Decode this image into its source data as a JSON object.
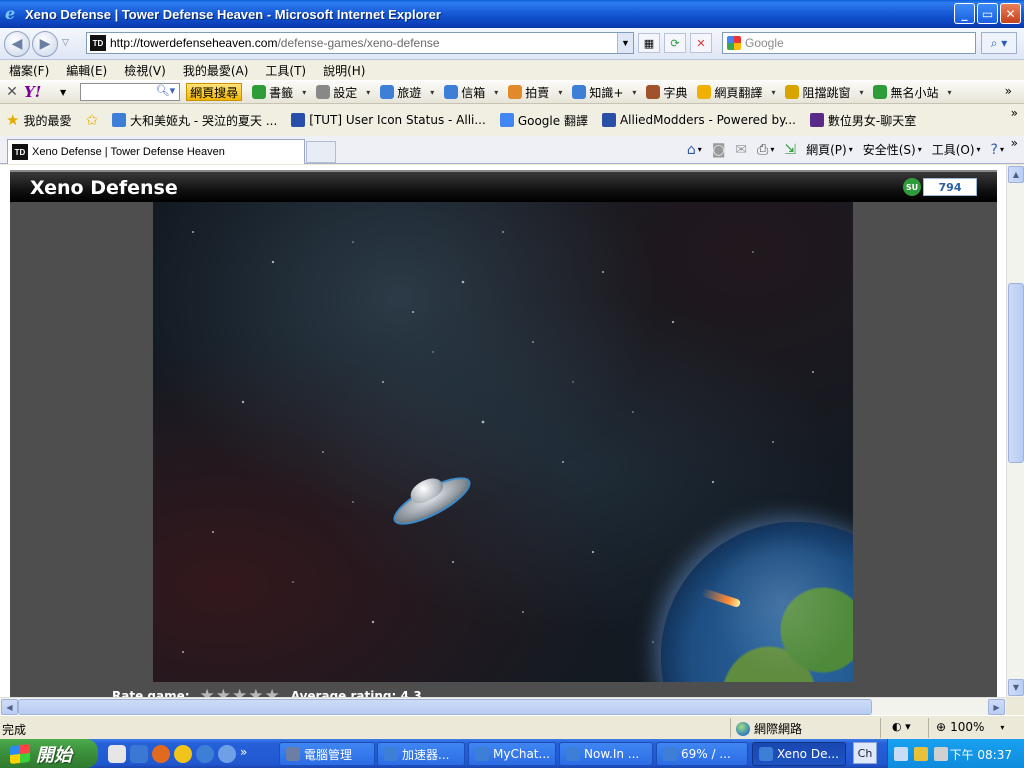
{
  "window": {
    "title": "Xeno Defense | Tower Defense Heaven - Microsoft Internet Explorer",
    "buttons": {
      "minimize": "_",
      "maximize": "▭",
      "close": "✕"
    }
  },
  "address_bar": {
    "url_host": "http://towerdefenseheaven.com",
    "url_path": "/defense-games/xeno-defense",
    "favicon_text": "TD"
  },
  "search_box": {
    "placeholder": "Google"
  },
  "menu": {
    "items": [
      "檔案(F)",
      "編輯(E)",
      "檢視(V)",
      "我的最愛(A)",
      "工具(T)",
      "說明(H)"
    ]
  },
  "yahoo_toolbar": {
    "logo": "Y!",
    "search_label": "網頁搜尋",
    "items": [
      {
        "label": "書籤",
        "color": "#2f9c3a"
      },
      {
        "label": "設定",
        "color": "#888888"
      },
      {
        "label": "旅遊",
        "color": "#3d7fd6"
      },
      {
        "label": "信箱",
        "color": "#3d7fd6"
      },
      {
        "label": "拍賣",
        "color": "#e08a2a"
      },
      {
        "label": "知識+",
        "color": "#3d7fd6"
      },
      {
        "label": "字典",
        "color": "#a0522d"
      },
      {
        "label": "網頁翻譯",
        "color": "#f0b000"
      },
      {
        "label": "阻擋跳窗",
        "color": "#d9a300"
      },
      {
        "label": "無名小站",
        "color": "#2f9c3a"
      }
    ],
    "more": "»"
  },
  "favorites_bar": {
    "label": "我的最愛",
    "items": [
      {
        "label": "大和美姬丸 - 哭泣的夏天 ...",
        "color": "#3d7fd6"
      },
      {
        "label": "[TUT] User Icon Status - Alli...",
        "color": "#2a4fa8"
      },
      {
        "label": "Google 翻譯",
        "color": "#4285f4"
      },
      {
        "label": "AlliedModders - Powered by...",
        "color": "#2a4fa8"
      },
      {
        "label": "數位男女-聊天室",
        "color": "#5a2a88"
      }
    ],
    "more": "»"
  },
  "tabs": {
    "active": "Xeno Defense | Tower Defense Heaven",
    "commands": [
      "網頁(P)",
      "安全性(S)",
      "工具(O)"
    ],
    "more": "»"
  },
  "game": {
    "title": "Xeno Defense",
    "stumble_label": "SU",
    "stumble_count": "794",
    "rate_label": "Rate game:",
    "stars": "★★★★★",
    "average_label": "Average rating: 4.3"
  },
  "status_bar": {
    "status": "完成",
    "zone": "網際網路",
    "zoom": "100%"
  },
  "taskbar": {
    "start": "開始",
    "buttons": [
      {
        "label": "電腦管理",
        "color": "#6b7fa5"
      },
      {
        "label": "加速器...",
        "color": "#3d7fd6"
      },
      {
        "label": "MyChat...",
        "color": "#3d7fd6"
      },
      {
        "label": "Now.In ...",
        "color": "#3d7fd6"
      },
      {
        "label": "69% / ...",
        "color": "#3d7fd6"
      },
      {
        "label": "Xeno De...",
        "color": "#3d7fd6"
      }
    ],
    "lang": "Ch",
    "clock": "下午 08:37"
  }
}
